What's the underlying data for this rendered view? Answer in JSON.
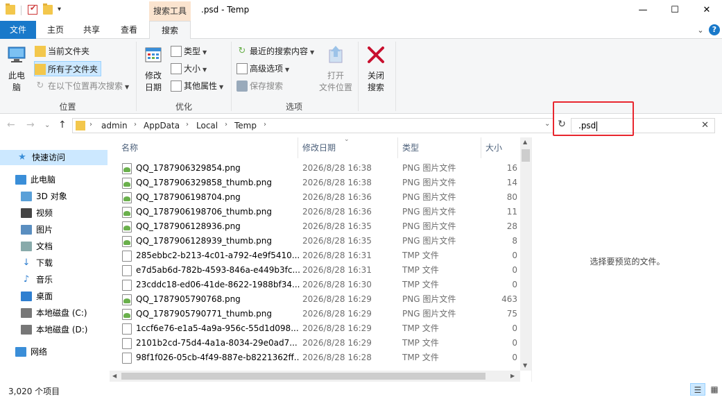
{
  "window": {
    "title": ".psd - Temp",
    "context_tab": "搜索工具",
    "controls": {
      "minimize": "—",
      "maximize": "☐",
      "close": "✕"
    },
    "quick_access_dropdown": "▾"
  },
  "tabs": [
    {
      "label": "文件"
    },
    {
      "label": "主页"
    },
    {
      "label": "共享"
    },
    {
      "label": "查看"
    },
    {
      "label": "搜索"
    }
  ],
  "ribbon": {
    "location": {
      "group_label": "位置",
      "this_pc": "此电\n脑",
      "current_folder": "当前文件夹",
      "all_subfolders": "所有子文件夹",
      "search_again": "在以下位置再次搜索"
    },
    "refine": {
      "group_label": "优化",
      "date_modified": "修改\n日期",
      "kind": "类型",
      "size": "大小",
      "other_props": "其他属性"
    },
    "options": {
      "group_label": "选项",
      "recent_searches": "最近的搜索内容",
      "advanced": "高级选项",
      "save_search": "保存搜索",
      "open_location": "打开\n文件位置"
    },
    "close": {
      "label": "关闭\n搜索"
    }
  },
  "address": {
    "breadcrumbs": [
      "admin",
      "AppData",
      "Local",
      "Temp"
    ],
    "search_value": ".psd",
    "search_clear": "✕"
  },
  "nav_pane": [
    {
      "label": "快速访问",
      "icon": "star-icon",
      "selected": true
    },
    {
      "label": "此电脑",
      "icon": "computer-icon"
    },
    {
      "label": "3D 对象",
      "icon": "3d-objects-icon"
    },
    {
      "label": "视频",
      "icon": "video-icon"
    },
    {
      "label": "图片",
      "icon": "pictures-icon"
    },
    {
      "label": "文档",
      "icon": "documents-icon"
    },
    {
      "label": "下载",
      "icon": "download-icon"
    },
    {
      "label": "音乐",
      "icon": "music-icon"
    },
    {
      "label": "桌面",
      "icon": "desktop-icon"
    },
    {
      "label": "本地磁盘 (C:)",
      "icon": "drive-c-icon"
    },
    {
      "label": "本地磁盘 (D:)",
      "icon": "drive-d-icon"
    },
    {
      "label": "网络",
      "icon": "network-icon"
    }
  ],
  "columns": {
    "name": "名称",
    "date": "修改日期",
    "type": "类型",
    "size": "大小"
  },
  "files": [
    {
      "name": "QQ_1787906329854.png",
      "date": "2026/8/28 16:38",
      "type": "PNG 图片文件",
      "size": "16",
      "icon": "png"
    },
    {
      "name": "QQ_1787906329858_thumb.png",
      "date": "2026/8/28 16:38",
      "type": "PNG 图片文件",
      "size": "14",
      "icon": "png"
    },
    {
      "name": "QQ_1787906198704.png",
      "date": "2026/8/28 16:36",
      "type": "PNG 图片文件",
      "size": "80",
      "icon": "png"
    },
    {
      "name": "QQ_1787906198706_thumb.png",
      "date": "2026/8/28 16:36",
      "type": "PNG 图片文件",
      "size": "11",
      "icon": "png"
    },
    {
      "name": "QQ_1787906128936.png",
      "date": "2026/8/28 16:35",
      "type": "PNG 图片文件",
      "size": "28",
      "icon": "png"
    },
    {
      "name": "QQ_1787906128939_thumb.png",
      "date": "2026/8/28 16:35",
      "type": "PNG 图片文件",
      "size": "8",
      "icon": "png"
    },
    {
      "name": "285ebbc2-b213-4c01-a792-4e9f5410...",
      "date": "2026/8/28 16:31",
      "type": "TMP 文件",
      "size": "0",
      "icon": "tmp"
    },
    {
      "name": "e7d5ab6d-782b-4593-846a-e449b3fc...",
      "date": "2026/8/28 16:31",
      "type": "TMP 文件",
      "size": "0",
      "icon": "tmp"
    },
    {
      "name": "23cddc18-ed06-41de-8622-1988bf34...",
      "date": "2026/8/28 16:30",
      "type": "TMP 文件",
      "size": "0",
      "icon": "tmp"
    },
    {
      "name": "QQ_1787905790768.png",
      "date": "2026/8/28 16:29",
      "type": "PNG 图片文件",
      "size": "463",
      "icon": "png"
    },
    {
      "name": "QQ_1787905790771_thumb.png",
      "date": "2026/8/28 16:29",
      "type": "PNG 图片文件",
      "size": "75",
      "icon": "png"
    },
    {
      "name": "1ccf6e76-e1a5-4a9a-956c-55d1d098...",
      "date": "2026/8/28 16:29",
      "type": "TMP 文件",
      "size": "0",
      "icon": "tmp"
    },
    {
      "name": "2101b2cd-75d4-4a1a-8034-29e0ad7...",
      "date": "2026/8/28 16:29",
      "type": "TMP 文件",
      "size": "0",
      "icon": "tmp"
    },
    {
      "name": "98f1f026-05cb-4f49-887e-b8221362ff...",
      "date": "2026/8/28 16:28",
      "type": "TMP 文件",
      "size": "0",
      "icon": "tmp"
    }
  ],
  "preview": {
    "message": "选择要预览的文件。"
  },
  "status": {
    "count": "3,020 个项目"
  },
  "colors": {
    "accent": "#1979ca",
    "context_tab": "#fbe4cf",
    "selection": "#cce8ff",
    "highlight_box": "#e8262e"
  }
}
